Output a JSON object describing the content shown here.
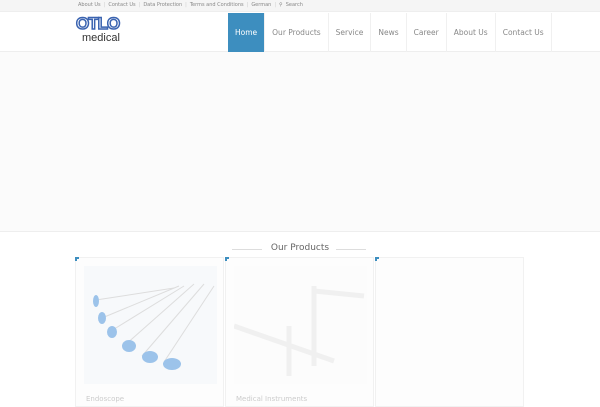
{
  "topbar": {
    "links": [
      "About Us",
      "Contact Us",
      "Data Protection",
      "Terms and Conditions",
      "German"
    ],
    "search_label": "Search"
  },
  "logo": {
    "brand": "OTLO",
    "sub": "medical"
  },
  "nav": {
    "items": [
      "Home",
      "Our Products",
      "Service",
      "News",
      "Career",
      "About Us",
      "Contact Us"
    ],
    "active": "Home"
  },
  "section": {
    "title": "Our Products"
  },
  "products": [
    {
      "name": "Endoscope"
    },
    {
      "name": "Medical Instruments"
    },
    {
      "name": ""
    }
  ],
  "colors": {
    "accent": "#3d8ebf",
    "logo": "#3a63b0"
  }
}
